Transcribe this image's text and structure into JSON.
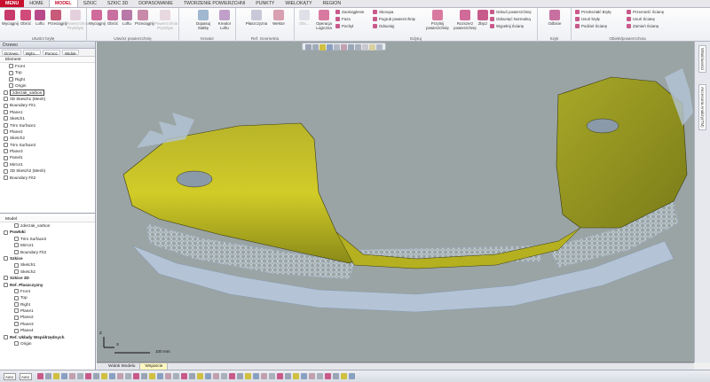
{
  "menu": {
    "menu_button": "MENU",
    "tabs": [
      "HOME",
      "MODEL",
      "SZKIC",
      "SZKIC 3D",
      "DOPASOWANIE",
      "TWORZENIE POWIERZCHNI",
      "PUNKTY",
      "WIELOKĄTY",
      "REGION"
    ],
    "active_tab": "MODEL"
  },
  "ribbon": {
    "groups": {
      "solid": {
        "title": "Utwórz bryłę",
        "buttons": [
          "Wyciągnij",
          "Obróć",
          "Loftu",
          "Przeciągnij",
          "Powierzchnia Prymityw"
        ]
      },
      "surface": {
        "title": "Utwórz powierzchnię",
        "buttons": [
          "Wyciągnij",
          "Obróć",
          "Loftu",
          "Przeciągnij",
          "Powierzchnia Prymityw"
        ]
      },
      "wizard": {
        "title": "Kreator",
        "buttons": [
          "Dopasuj Siatkę",
          "Kreator Loftu"
        ]
      },
      "refgeo": {
        "title": "Ref. Geometria",
        "buttons": [
          "Płaszczyzna",
          "Wektor"
        ]
      },
      "edit": {
        "title": "Edytuj",
        "buttons": [
          "Obc...",
          "Operacja Logiczna",
          "Przytnij powierzchnię",
          "Rozszerz powierzchnię",
          "Złącz"
        ],
        "small": [
          "Zaokrąglenie",
          "Faza",
          "Pochył",
          "Skorupa",
          "Pogrub powierzchnię",
          "Odsunięj",
          "Odsuń powierzchnię",
          "Odsunięć Normalną",
          "Wypełnij Ścianę"
        ]
      },
      "pattern": {
        "title": "Szyk",
        "buttons": [
          "Odbicie"
        ]
      },
      "body": {
        "title": "Obiekt/powierzchnia",
        "small": [
          "Przekształć Bryłę",
          "Usuń bryłę",
          "Podziel Ścianę",
          "Przemieść Ścianę",
          "Usuń Ścianę",
          "Zamień Ścianę"
        ]
      }
    }
  },
  "feature_tree": {
    "pane_title": "Drzewo",
    "tabs": [
      "Drzewo",
      "Wybi...",
      "Pomoc",
      "Widok"
    ],
    "column": "Element",
    "items": [
      "Front",
      "Top",
      "Right",
      "Origin",
      "zderzak_varbon",
      "3D Sketch1 (Mesh)",
      "Boundary Fit1",
      "Plane1",
      "Sketch1",
      "Trim Surface1",
      "Plane2",
      "Sketch2",
      "Trim Surface2",
      "Plane3",
      "Panel1",
      "Mirror1",
      "3D Sketch2 (Mesh)",
      "Boundary Fit2"
    ],
    "editing_item": "zderzak_varbon"
  },
  "model_tree": {
    "column": "Model",
    "items": [
      {
        "label": "zderzak_varbon",
        "bold": false
      },
      {
        "label": "Powłoki",
        "bold": true
      },
      {
        "label": "Trim Surface2",
        "bold": false
      },
      {
        "label": "Mirror1",
        "bold": false
      },
      {
        "label": "Boundary Fit2",
        "bold": false
      },
      {
        "label": "Szkice",
        "bold": true
      },
      {
        "label": "Sketch1",
        "bold": false
      },
      {
        "label": "Sketch2",
        "bold": false
      },
      {
        "label": "Szkice 3D",
        "bold": true
      },
      {
        "label": "Ref. Płaszczyzny",
        "bold": true
      },
      {
        "label": "Front",
        "bold": false
      },
      {
        "label": "Top",
        "bold": false
      },
      {
        "label": "Right",
        "bold": false
      },
      {
        "label": "Plane1",
        "bold": false
      },
      {
        "label": "Plane2",
        "bold": false
      },
      {
        "label": "Plane3",
        "bold": false
      },
      {
        "label": "Plane4",
        "bold": false
      },
      {
        "label": "Ref. Układy Współrzędnych",
        "bold": true
      },
      {
        "label": "Origin",
        "bold": false
      }
    ]
  },
  "viewport": {
    "scale_label": "100 mm",
    "axis_z": "Z",
    "axis_x": "X"
  },
  "right_tabs": [
    "Właściwości",
    "Akcesoria Analizy(TM)"
  ],
  "view_tabs": [
    "Widok Modelu",
    "Wsparcie"
  ],
  "active_view_tab": "Wsparcie",
  "status": {
    "select1": "Auto",
    "select2": "Auto"
  },
  "colors": {
    "accent": "#c8102e",
    "surface_yellow": "#c8c020",
    "mesh_blue": "#b8c8d8",
    "background": "#9aa4a4"
  }
}
